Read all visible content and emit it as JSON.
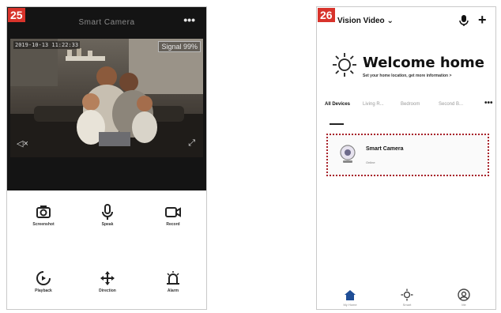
{
  "screen25": {
    "step_number": "25",
    "title": "Smart Camera",
    "more_icon": "more-dots-icon",
    "timestamp": "2019-10-13 11:22:33",
    "signal": "Signal 99%",
    "controls": [
      {
        "label": "Screenshot",
        "icon": "camera-icon"
      },
      {
        "label": "Speak",
        "icon": "microphone-icon"
      },
      {
        "label": "Record",
        "icon": "video-record-icon"
      },
      {
        "label": "Playback",
        "icon": "playback-icon"
      },
      {
        "label": "Direction",
        "icon": "direction-icon"
      },
      {
        "label": "Alarm",
        "icon": "alarm-icon"
      }
    ]
  },
  "screen26": {
    "step_number": "26",
    "home_selector": "Vision Video",
    "welcome_title": "Welcome home",
    "welcome_subtitle": "Set your home location, get more information >",
    "tabs": [
      "All Devices",
      "Living R...",
      "Bedroom",
      "Second B..."
    ],
    "device": {
      "name": "Smart Camera",
      "status": "Online"
    },
    "nav": [
      {
        "label": "My Home",
        "icon": "home-icon"
      },
      {
        "label": "Smart",
        "icon": "smart-scene-icon"
      },
      {
        "label": "Me",
        "icon": "profile-icon"
      }
    ]
  },
  "colors": {
    "badge": "#d8332b",
    "card_border": "#a8232b",
    "video_background": "#141414",
    "nav_active": "#1f4e96"
  }
}
